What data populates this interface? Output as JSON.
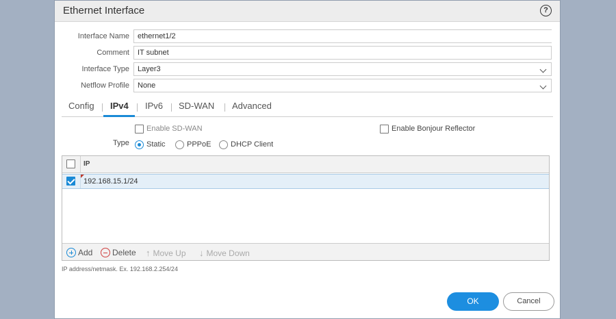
{
  "dialog": {
    "title": "Ethernet Interface",
    "help_icon": "question-circle-icon"
  },
  "fields": {
    "interface_name": {
      "label": "Interface Name",
      "value": "ethernet1/2"
    },
    "comment": {
      "label": "Comment",
      "value": "IT subnet"
    },
    "interface_type": {
      "label": "Interface Type",
      "value": "Layer3"
    },
    "netflow_profile": {
      "label": "Netflow Profile",
      "value": "None"
    }
  },
  "tabs": [
    {
      "label": "Config"
    },
    {
      "label": "IPv4"
    },
    {
      "label": "IPv6"
    },
    {
      "label": "SD-WAN"
    },
    {
      "label": "Advanced"
    }
  ],
  "ipv4": {
    "enable_sdwan": {
      "label": "Enable SD-WAN",
      "checked": false
    },
    "enable_bonjour": {
      "label": "Enable Bonjour Reflector",
      "checked": false
    },
    "type": {
      "label": "Type",
      "options": [
        {
          "label": "Static",
          "selected": true
        },
        {
          "label": "PPPoE",
          "selected": false
        },
        {
          "label": "DHCP Client",
          "selected": false
        }
      ]
    },
    "grid": {
      "column_header": "IP",
      "rows": [
        {
          "value": "192.168.15.1/24",
          "checked": true
        }
      ]
    },
    "footer": {
      "add": "Add",
      "delete": "Delete",
      "move_up": "Move Up",
      "move_down": "Move Down"
    },
    "hint": "IP address/netmask. Ex. 192.168.2.254/24"
  },
  "buttons": {
    "ok": "OK",
    "cancel": "Cancel"
  },
  "colors": {
    "accent": "#1d8ee0",
    "background": "#a3b0c2",
    "delete": "#d04040"
  }
}
